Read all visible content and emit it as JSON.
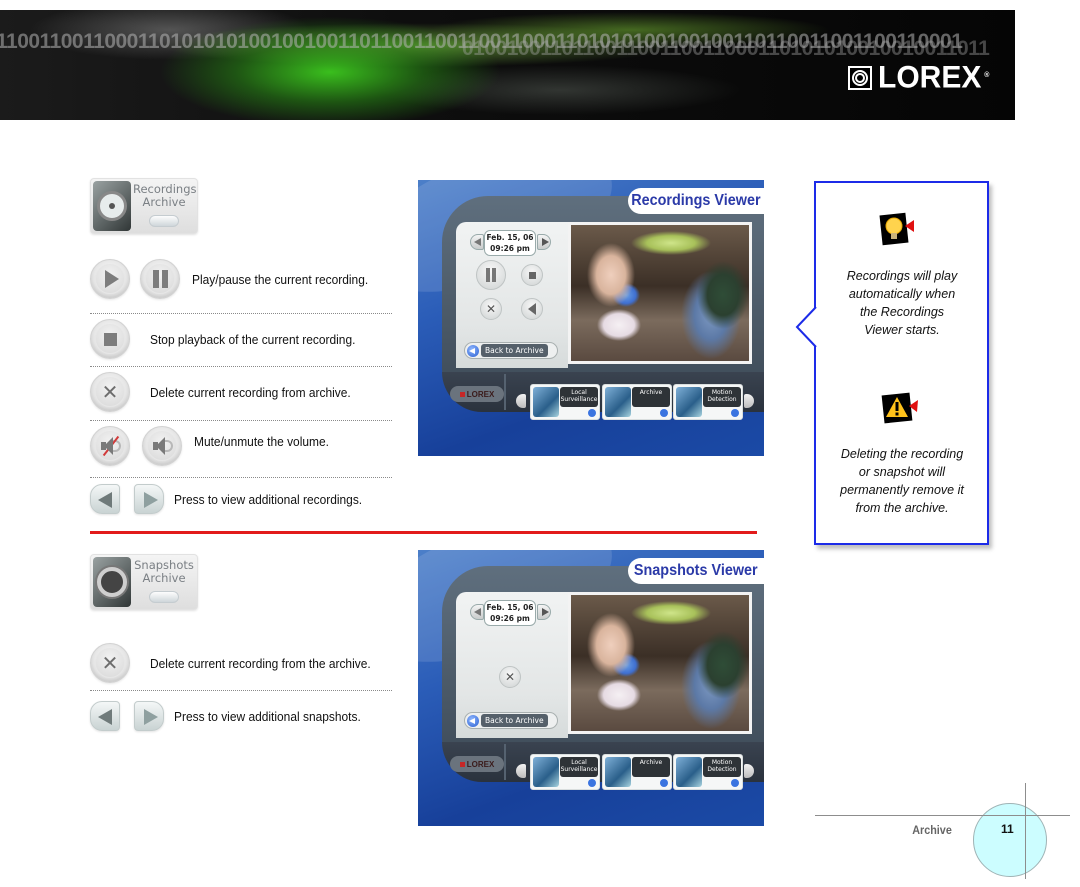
{
  "header": {
    "binary_line_1": "1100110011000110101010100100100110110011001100110001101010100100100110110011001100110001",
    "binary_line_2": "010010011011001100110011000110101010010010011011",
    "brand": "LOREX",
    "brand_registered": "®"
  },
  "recordings_section": {
    "badge": {
      "line1": "Recordings",
      "line2": "Archive"
    },
    "rows": [
      {
        "icons": [
          "play-icon",
          "pause-icon"
        ],
        "text": "Play/pause the current recording."
      },
      {
        "icons": [
          "stop-icon"
        ],
        "text": "Stop playback of the current recording."
      },
      {
        "icons": [
          "delete-icon"
        ],
        "text": "Delete current recording from archive."
      },
      {
        "icons": [
          "mute-icon",
          "volume-icon"
        ],
        "text": "Mute/unmute the volume."
      },
      {
        "icons": [
          "previous-arrow-icon",
          "next-arrow-icon"
        ],
        "text": "Press to view additional recordings."
      }
    ],
    "viewer": {
      "title": "Recordings Viewer",
      "date": "Feb. 15, 06",
      "time": "09:26 pm",
      "back_button": "Back to Archive",
      "dock_logo": "LOREX",
      "dock_tiles": [
        {
          "line1": "Local",
          "line2": "Surveillance"
        },
        {
          "line1": "Archive",
          "line2": ""
        },
        {
          "line1": "Motion",
          "line2": "Detection"
        }
      ]
    }
  },
  "snapshots_section": {
    "badge": {
      "line1": "Snapshots",
      "line2": "Archive"
    },
    "rows": [
      {
        "icons": [
          "delete-icon"
        ],
        "text": "Delete current recording from the archive."
      },
      {
        "icons": [
          "previous-arrow-icon",
          "next-arrow-icon"
        ],
        "text": "Press to view additional snapshots."
      }
    ],
    "viewer": {
      "title": "Snapshots Viewer",
      "date": "Feb. 15, 06",
      "time": "09:26 pm",
      "back_button": "Back to Archive",
      "dock_logo": "LOREX",
      "dock_tiles": [
        {
          "line1": "Local",
          "line2": "Surveillance"
        },
        {
          "line1": "Archive",
          "line2": ""
        },
        {
          "line1": "Motion",
          "line2": "Detection"
        }
      ]
    }
  },
  "callout": {
    "tip": {
      "icon": "lightbulb-icon",
      "lines": [
        "Recordings will play",
        "automatically when",
        "the Recordings",
        "Viewer starts."
      ]
    },
    "warning": {
      "icon": "warning-icon",
      "lines": [
        "Deleting the recording",
        "or snapshot will",
        "permanently remove it",
        "from the archive."
      ]
    },
    "border_color": "#1c2be8"
  },
  "footer": {
    "section": "Archive",
    "page": "11"
  },
  "colors": {
    "divider_red": "#e21b1b",
    "viewer_title_blue": "#2b3aa8",
    "page_circle": "#ccfdff"
  }
}
